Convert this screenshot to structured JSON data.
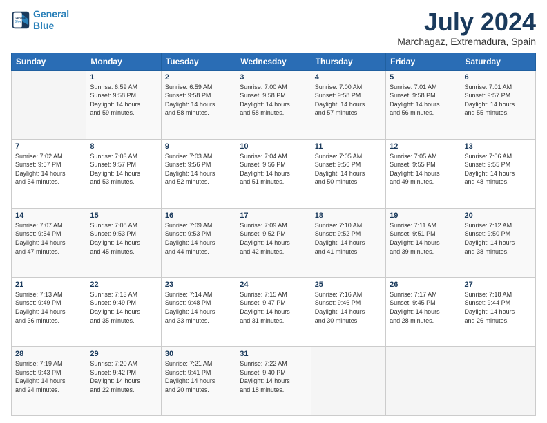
{
  "logo": {
    "line1": "General",
    "line2": "Blue"
  },
  "title": {
    "month_year": "July 2024",
    "location": "Marchagaz, Extremadura, Spain"
  },
  "calendar": {
    "headers": [
      "Sunday",
      "Monday",
      "Tuesday",
      "Wednesday",
      "Thursday",
      "Friday",
      "Saturday"
    ],
    "weeks": [
      [
        {
          "day": "",
          "info": ""
        },
        {
          "day": "1",
          "info": "Sunrise: 6:59 AM\nSunset: 9:58 PM\nDaylight: 14 hours\nand 59 minutes."
        },
        {
          "day": "2",
          "info": "Sunrise: 6:59 AM\nSunset: 9:58 PM\nDaylight: 14 hours\nand 58 minutes."
        },
        {
          "day": "3",
          "info": "Sunrise: 7:00 AM\nSunset: 9:58 PM\nDaylight: 14 hours\nand 58 minutes."
        },
        {
          "day": "4",
          "info": "Sunrise: 7:00 AM\nSunset: 9:58 PM\nDaylight: 14 hours\nand 57 minutes."
        },
        {
          "day": "5",
          "info": "Sunrise: 7:01 AM\nSunset: 9:58 PM\nDaylight: 14 hours\nand 56 minutes."
        },
        {
          "day": "6",
          "info": "Sunrise: 7:01 AM\nSunset: 9:57 PM\nDaylight: 14 hours\nand 55 minutes."
        }
      ],
      [
        {
          "day": "7",
          "info": "Sunrise: 7:02 AM\nSunset: 9:57 PM\nDaylight: 14 hours\nand 54 minutes."
        },
        {
          "day": "8",
          "info": "Sunrise: 7:03 AM\nSunset: 9:57 PM\nDaylight: 14 hours\nand 53 minutes."
        },
        {
          "day": "9",
          "info": "Sunrise: 7:03 AM\nSunset: 9:56 PM\nDaylight: 14 hours\nand 52 minutes."
        },
        {
          "day": "10",
          "info": "Sunrise: 7:04 AM\nSunset: 9:56 PM\nDaylight: 14 hours\nand 51 minutes."
        },
        {
          "day": "11",
          "info": "Sunrise: 7:05 AM\nSunset: 9:56 PM\nDaylight: 14 hours\nand 50 minutes."
        },
        {
          "day": "12",
          "info": "Sunrise: 7:05 AM\nSunset: 9:55 PM\nDaylight: 14 hours\nand 49 minutes."
        },
        {
          "day": "13",
          "info": "Sunrise: 7:06 AM\nSunset: 9:55 PM\nDaylight: 14 hours\nand 48 minutes."
        }
      ],
      [
        {
          "day": "14",
          "info": "Sunrise: 7:07 AM\nSunset: 9:54 PM\nDaylight: 14 hours\nand 47 minutes."
        },
        {
          "day": "15",
          "info": "Sunrise: 7:08 AM\nSunset: 9:53 PM\nDaylight: 14 hours\nand 45 minutes."
        },
        {
          "day": "16",
          "info": "Sunrise: 7:09 AM\nSunset: 9:53 PM\nDaylight: 14 hours\nand 44 minutes."
        },
        {
          "day": "17",
          "info": "Sunrise: 7:09 AM\nSunset: 9:52 PM\nDaylight: 14 hours\nand 42 minutes."
        },
        {
          "day": "18",
          "info": "Sunrise: 7:10 AM\nSunset: 9:52 PM\nDaylight: 14 hours\nand 41 minutes."
        },
        {
          "day": "19",
          "info": "Sunrise: 7:11 AM\nSunset: 9:51 PM\nDaylight: 14 hours\nand 39 minutes."
        },
        {
          "day": "20",
          "info": "Sunrise: 7:12 AM\nSunset: 9:50 PM\nDaylight: 14 hours\nand 38 minutes."
        }
      ],
      [
        {
          "day": "21",
          "info": "Sunrise: 7:13 AM\nSunset: 9:49 PM\nDaylight: 14 hours\nand 36 minutes."
        },
        {
          "day": "22",
          "info": "Sunrise: 7:13 AM\nSunset: 9:49 PM\nDaylight: 14 hours\nand 35 minutes."
        },
        {
          "day": "23",
          "info": "Sunrise: 7:14 AM\nSunset: 9:48 PM\nDaylight: 14 hours\nand 33 minutes."
        },
        {
          "day": "24",
          "info": "Sunrise: 7:15 AM\nSunset: 9:47 PM\nDaylight: 14 hours\nand 31 minutes."
        },
        {
          "day": "25",
          "info": "Sunrise: 7:16 AM\nSunset: 9:46 PM\nDaylight: 14 hours\nand 30 minutes."
        },
        {
          "day": "26",
          "info": "Sunrise: 7:17 AM\nSunset: 9:45 PM\nDaylight: 14 hours\nand 28 minutes."
        },
        {
          "day": "27",
          "info": "Sunrise: 7:18 AM\nSunset: 9:44 PM\nDaylight: 14 hours\nand 26 minutes."
        }
      ],
      [
        {
          "day": "28",
          "info": "Sunrise: 7:19 AM\nSunset: 9:43 PM\nDaylight: 14 hours\nand 24 minutes."
        },
        {
          "day": "29",
          "info": "Sunrise: 7:20 AM\nSunset: 9:42 PM\nDaylight: 14 hours\nand 22 minutes."
        },
        {
          "day": "30",
          "info": "Sunrise: 7:21 AM\nSunset: 9:41 PM\nDaylight: 14 hours\nand 20 minutes."
        },
        {
          "day": "31",
          "info": "Sunrise: 7:22 AM\nSunset: 9:40 PM\nDaylight: 14 hours\nand 18 minutes."
        },
        {
          "day": "",
          "info": ""
        },
        {
          "day": "",
          "info": ""
        },
        {
          "day": "",
          "info": ""
        }
      ]
    ]
  }
}
